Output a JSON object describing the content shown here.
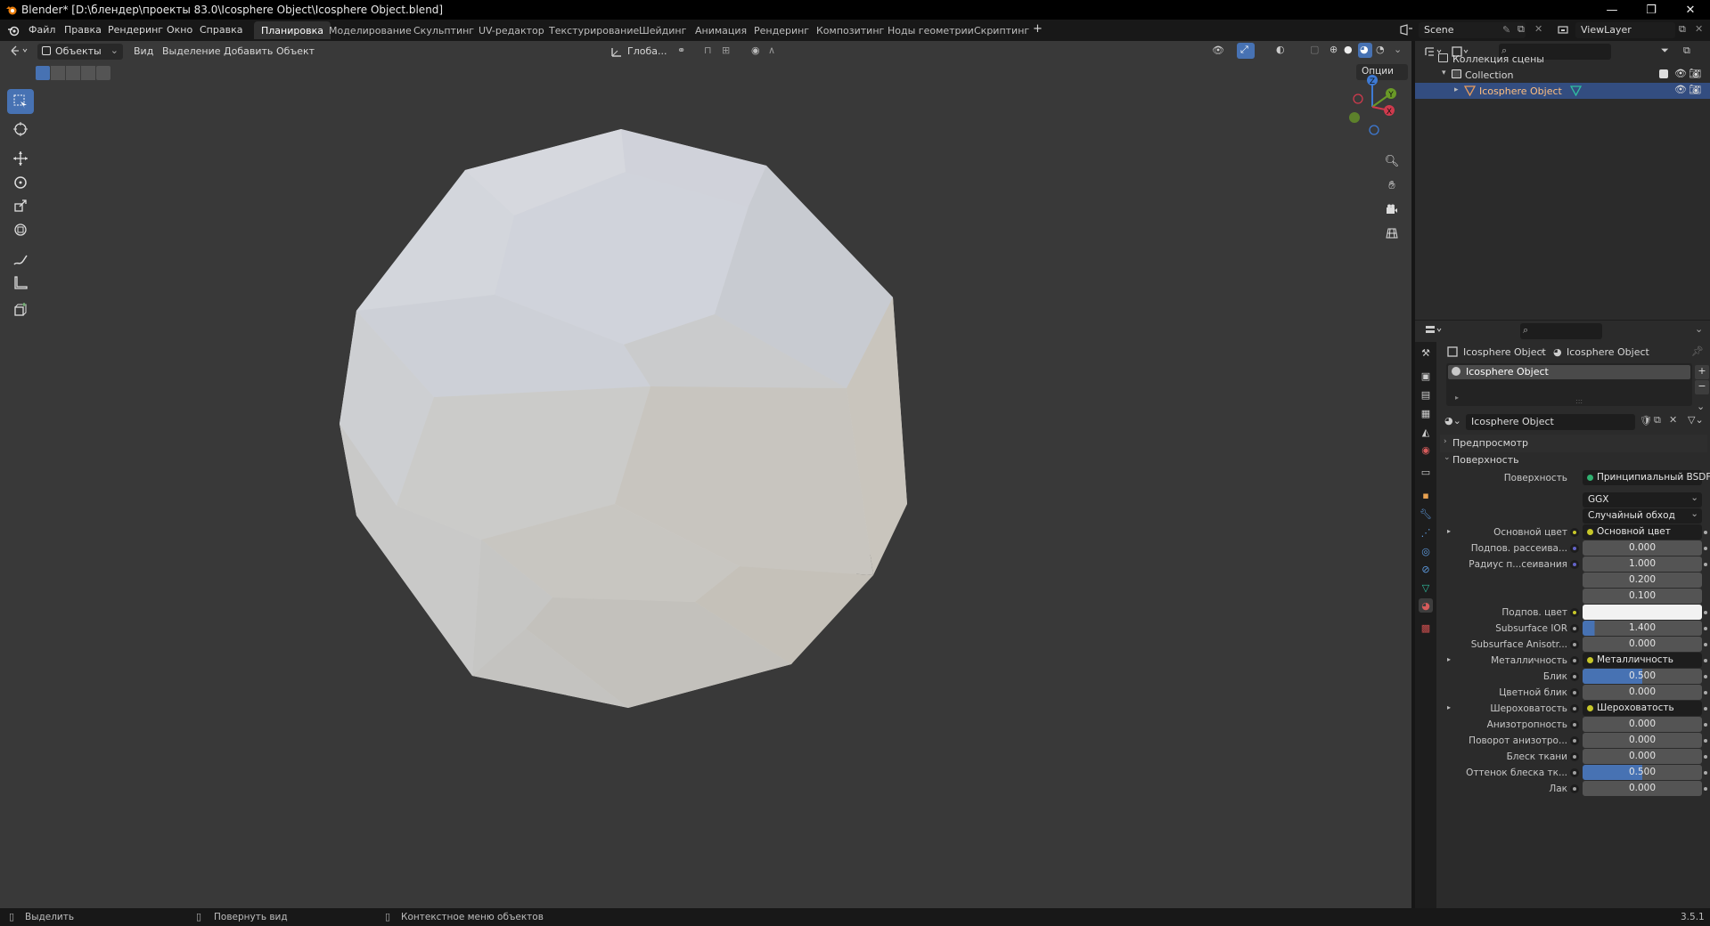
{
  "window": {
    "title": "Blender* [D:\\блендер\\проекты 83.0\\Icosphere Object\\Icosphere Object.blend]"
  },
  "menu": [
    "Файл",
    "Правка",
    "Рендеринг",
    "Окно",
    "Справка"
  ],
  "workspaces": [
    "Планировка",
    "Моделирование",
    "Скульптинг",
    "UV-редактор",
    "Текстурирование",
    "Шейдинг",
    "Анимация",
    "Рендеринг",
    "Композитинг",
    "Ноды геометрии",
    "Скриптинг"
  ],
  "active_workspace": "Планировка",
  "scene": {
    "name": "Scene",
    "view_layer": "ViewLayer"
  },
  "viewport": {
    "mode": "Объекты",
    "menus": [
      "Вид",
      "Выделение",
      "Добавить",
      "Объект"
    ],
    "transform_orientation": "Глоба...",
    "options_label": "Опции",
    "gizmo_axes": {
      "z": "Z",
      "y": "Y",
      "x": "X"
    }
  },
  "outliner": {
    "search_placeholder": "",
    "scene_collection": "Коллекция сцены",
    "collection": "Collection",
    "object": "Icosphere Object"
  },
  "properties": {
    "breadcrumb_object": "Icosphere Object",
    "breadcrumb_material": "Icosphere Object",
    "material_slot": "Icosphere Object",
    "material_name": "Icosphere Object",
    "panels": {
      "preview": "Предпросмотр",
      "surface": "Поверхность"
    },
    "surface_label": "Поверхность",
    "surface_value": "Принципиальный BSDF",
    "distribution": "GGX",
    "subsurface_method": "Случайный обход",
    "rows": [
      {
        "label": "Основной цвет",
        "type": "link",
        "value": "Основной цвет",
        "dot": "#c7c729",
        "expand": true
      },
      {
        "label": "Подпов. рассеива...",
        "type": "num",
        "value": "0.000",
        "dot": "#6363c7"
      },
      {
        "label": "Радиус п...сеивания",
        "type": "num",
        "value": "1.000",
        "dot": "#6363c7"
      },
      {
        "label": "",
        "type": "num",
        "value": "0.200",
        "dot": ""
      },
      {
        "label": "",
        "type": "num",
        "value": "0.100",
        "dot": ""
      },
      {
        "label": "Подпов. цвет",
        "type": "color",
        "value": "",
        "dot": "#c7c729"
      },
      {
        "label": "Subsurface IOR",
        "type": "bar",
        "value": "1.400",
        "fill": 0.1,
        "dot": "#a1a1a1"
      },
      {
        "label": "Subsurface Anisotr...",
        "type": "num",
        "value": "0.000",
        "dot": "#a1a1a1"
      },
      {
        "label": "Металличность",
        "type": "link",
        "value": "Металличность",
        "dot": "#a1a1a1",
        "expand": true
      },
      {
        "label": "Блик",
        "type": "bar",
        "value": "0.500",
        "fill": 0.5,
        "dot": "#a1a1a1"
      },
      {
        "label": "Цветной блик",
        "type": "num",
        "value": "0.000",
        "dot": "#a1a1a1"
      },
      {
        "label": "Шероховатость",
        "type": "link",
        "value": "Шероховатость",
        "dot": "#a1a1a1",
        "expand": true
      },
      {
        "label": "Анизотропность",
        "type": "num",
        "value": "0.000",
        "dot": "#a1a1a1"
      },
      {
        "label": "Поворот анизотро...",
        "type": "num",
        "value": "0.000",
        "dot": "#a1a1a1"
      },
      {
        "label": "Блеск ткани",
        "type": "num",
        "value": "0.000",
        "dot": "#a1a1a1"
      },
      {
        "label": "Оттенок блеска тк...",
        "type": "bar",
        "value": "0.500",
        "fill": 0.5,
        "dot": "#a1a1a1"
      },
      {
        "label": "Лак",
        "type": "num",
        "value": "0.000",
        "dot": "#a1a1a1"
      }
    ]
  },
  "status": {
    "select": "Выделить",
    "rotate": "Повернуть вид",
    "context": "Контекстное меню объектов",
    "version": "3.5.1"
  },
  "colors": {
    "accent": "#4772b3",
    "selected_row": "#334d80",
    "viewport_bg": "#393939"
  }
}
